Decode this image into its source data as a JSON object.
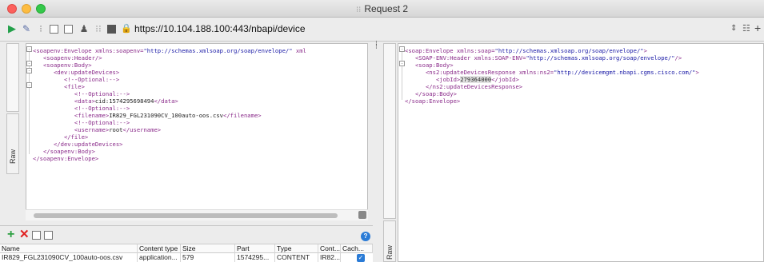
{
  "window": {
    "title": "Request 2",
    "doc_icon": "⁝⁝"
  },
  "toolbar": {
    "url": "https://10.104.188.100:443/nbapi/device",
    "icons": [
      "play-icon",
      "wand-icon",
      "tree-icon",
      "box-icon",
      "user-icon",
      "grid-icon",
      "lock-icon"
    ]
  },
  "tabs": {
    "left_raw": "Raw",
    "right_raw": "Raw"
  },
  "request_xml": [
    {
      "parts": [
        [
          "tag",
          "<soapenv:Envelope "
        ],
        [
          "attr",
          "xmlns:soapenv="
        ],
        [
          "val",
          "\"http://schemas.xmlsoap.org/soap/envelope/\""
        ],
        [
          "attr",
          " xml"
        ]
      ]
    },
    {
      "parts": [
        [
          "tag",
          "   <soapenv:Header/>"
        ]
      ]
    },
    {
      "parts": [
        [
          "tag",
          "   <soapenv:Body>"
        ]
      ]
    },
    {
      "parts": [
        [
          "tag",
          "      <dev:updateDevices>"
        ]
      ]
    },
    {
      "parts": [
        [
          "cmt",
          "         <!--Optional:-->"
        ]
      ]
    },
    {
      "parts": [
        [
          "tag",
          "         <file>"
        ]
      ]
    },
    {
      "parts": [
        [
          "cmt",
          "            <!--Optional:-->"
        ]
      ]
    },
    {
      "parts": [
        [
          "tag",
          "            <data>"
        ],
        [
          "txt",
          "cid:1574295698494"
        ],
        [
          "tag",
          "</data>"
        ]
      ]
    },
    {
      "parts": [
        [
          "cmt",
          "            <!--Optional:-->"
        ]
      ]
    },
    {
      "parts": [
        [
          "tag",
          "            <filename>"
        ],
        [
          "txt",
          "IR829_FGL231090CV_100auto-oos.csv"
        ],
        [
          "tag",
          "</filename>"
        ]
      ]
    },
    {
      "parts": [
        [
          "cmt",
          "            <!--Optional:-->"
        ]
      ]
    },
    {
      "parts": [
        [
          "tag",
          "            <username>"
        ],
        [
          "txt",
          "root"
        ],
        [
          "tag",
          "</username>"
        ]
      ]
    },
    {
      "parts": [
        [
          "tag",
          "         </file>"
        ]
      ]
    },
    {
      "parts": [
        [
          "tag",
          "      </dev:updateDevices>"
        ]
      ]
    },
    {
      "parts": [
        [
          "tag",
          "   </soapenv:Body>"
        ]
      ]
    },
    {
      "parts": [
        [
          "tag",
          "</soapenv:Envelope>"
        ]
      ]
    }
  ],
  "response_xml": [
    {
      "parts": [
        [
          "tag",
          "<soap:Envelope "
        ],
        [
          "attr",
          "xmlns:soap="
        ],
        [
          "val",
          "\"http://schemas.xmlsoap.org/soap/envelope/\""
        ],
        [
          "tag",
          ">"
        ]
      ]
    },
    {
      "parts": [
        [
          "tag",
          "   <SOAP-ENV:Header "
        ],
        [
          "attr",
          "xmlns:SOAP-ENV="
        ],
        [
          "val",
          "\"http://schemas.xmlsoap.org/soap/envelope/\""
        ],
        [
          "tag",
          "/>"
        ]
      ]
    },
    {
      "parts": [
        [
          "tag",
          "   <soap:Body>"
        ]
      ]
    },
    {
      "parts": [
        [
          "tag",
          "      <ns2:updateDevicesResponse "
        ],
        [
          "attr",
          "xmlns:ns2="
        ],
        [
          "val",
          "\"http://devicemgmt.nbapi.cgms.cisco.com/\""
        ],
        [
          "tag",
          ">"
        ]
      ]
    },
    {
      "parts": [
        [
          "tag",
          "         <jobId>"
        ],
        [
          "hl",
          "279364000"
        ],
        [
          "tag",
          "</jobId>"
        ]
      ]
    },
    {
      "parts": [
        [
          "tag",
          "      </ns2:updateDevicesResponse>"
        ]
      ]
    },
    {
      "parts": [
        [
          "tag",
          "   </soap:Body>"
        ]
      ]
    },
    {
      "parts": [
        [
          "tag",
          "</soap:Envelope>"
        ]
      ]
    }
  ],
  "attachments": {
    "columns": [
      "Name",
      "Content type",
      "Size",
      "Part",
      "Type",
      "Cont...",
      "Cach..."
    ],
    "rows": [
      {
        "name": "IR829_FGL231090CV_100auto-oos.csv",
        "content_type": "application...",
        "size": "579",
        "part": "1574295...",
        "type": "CONTENT",
        "cont": "IR82...",
        "cached": true
      }
    ]
  },
  "colors": {
    "tag": "#8a2b8a",
    "value": "#1a1aa6",
    "add": "#2ea043",
    "remove": "#e02020",
    "accent": "#2a7bd6"
  }
}
